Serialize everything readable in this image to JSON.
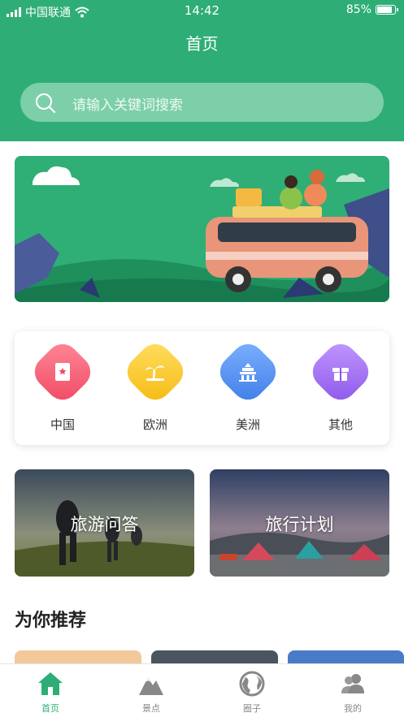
{
  "status": {
    "carrier": "中国联通",
    "time": "14:42",
    "battery": "85%"
  },
  "header": {
    "title": "首页",
    "search_placeholder": "请输入关键词搜索"
  },
  "categories": [
    {
      "label": "中国",
      "icon": "china-flag-icon",
      "color": "#f0506e"
    },
    {
      "label": "欧洲",
      "icon": "palm-tree-icon",
      "color": "#f8c81f"
    },
    {
      "label": "美洲",
      "icon": "landmark-icon",
      "color": "#4d8ff2"
    },
    {
      "label": "其他",
      "icon": "gift-icon",
      "color": "#9b63ee"
    }
  ],
  "cards": [
    {
      "label": "旅游问答"
    },
    {
      "label": "旅行计划"
    }
  ],
  "recommend": {
    "title": "为你推荐"
  },
  "tabs": [
    {
      "label": "首页",
      "icon": "home-icon",
      "active": true
    },
    {
      "label": "景点",
      "icon": "mountain-icon"
    },
    {
      "label": "圈子",
      "icon": "globe-icon"
    },
    {
      "label": "我的",
      "icon": "user-icon"
    }
  ],
  "colors": {
    "brand": "#2eae76"
  }
}
